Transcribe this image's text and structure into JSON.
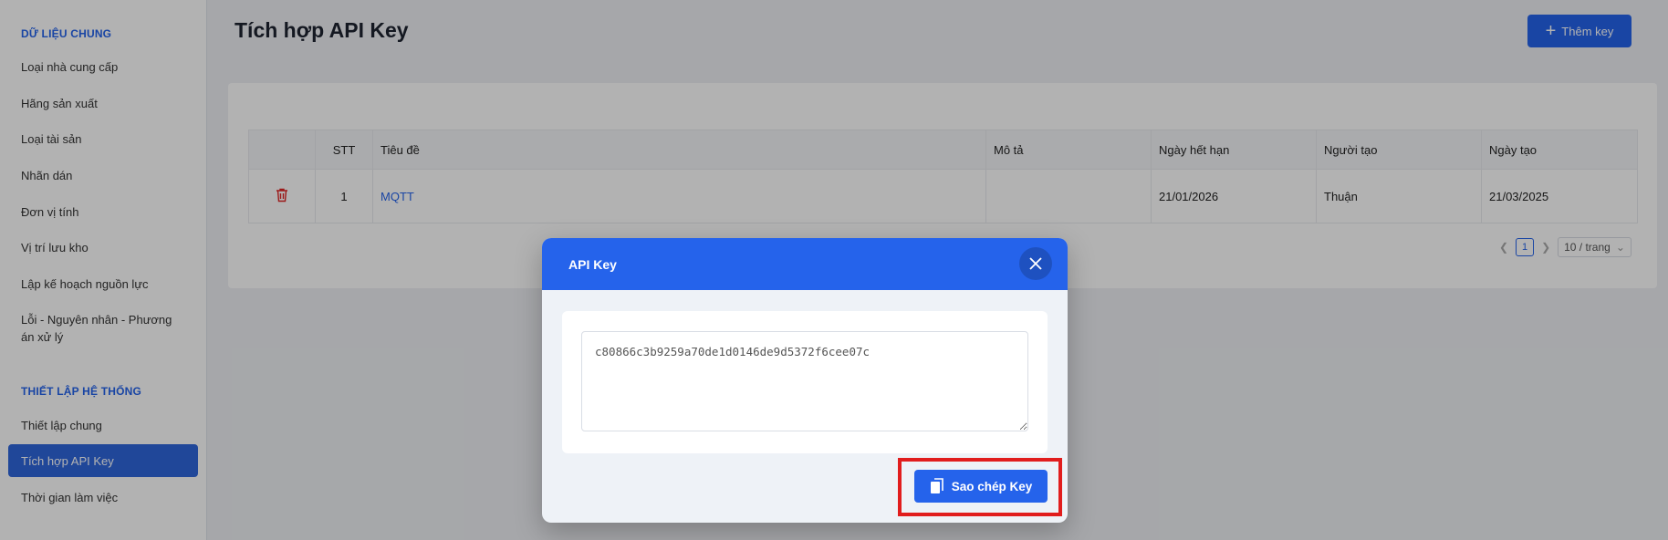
{
  "sidebar": {
    "section1": "DỮ LIỆU CHUNG",
    "items1": [
      "Loại nhà cung cấp",
      "Hãng sản xuất",
      "Loại tài sản",
      "Nhãn dán",
      "Đơn vị tính",
      "Vị trí lưu kho",
      "Lập kế hoạch nguồn lực",
      "Lỗi - Nguyên nhân - Phương án xử lý"
    ],
    "section2": "THIẾT LẬP HỆ THỐNG",
    "items2": [
      "Thiết lập chung",
      "Tích hợp API Key",
      "Thời gian làm việc"
    ]
  },
  "header": {
    "title": "Tích hợp API Key",
    "add_button": "Thêm key"
  },
  "table": {
    "columns": [
      "",
      "STT",
      "Tiêu đề",
      "Mô tả",
      "Ngày hết hạn",
      "Người tạo",
      "Ngày tạo"
    ],
    "rows": [
      {
        "stt": "1",
        "title": "MQTT",
        "description": "",
        "expiry": "21/01/2026",
        "creator": "Thuận",
        "created": "21/03/2025"
      }
    ]
  },
  "pagination": {
    "current_page": "1",
    "page_size": "10 / trang"
  },
  "modal": {
    "title": "API Key",
    "key_value": "c80866c3b9259a70de1d0146de9d5372f6cee07c",
    "copy_button": "Sao chép Key"
  },
  "colors": {
    "primary": "#2563eb",
    "highlight": "#e11d1d",
    "danger": "#e02424"
  }
}
